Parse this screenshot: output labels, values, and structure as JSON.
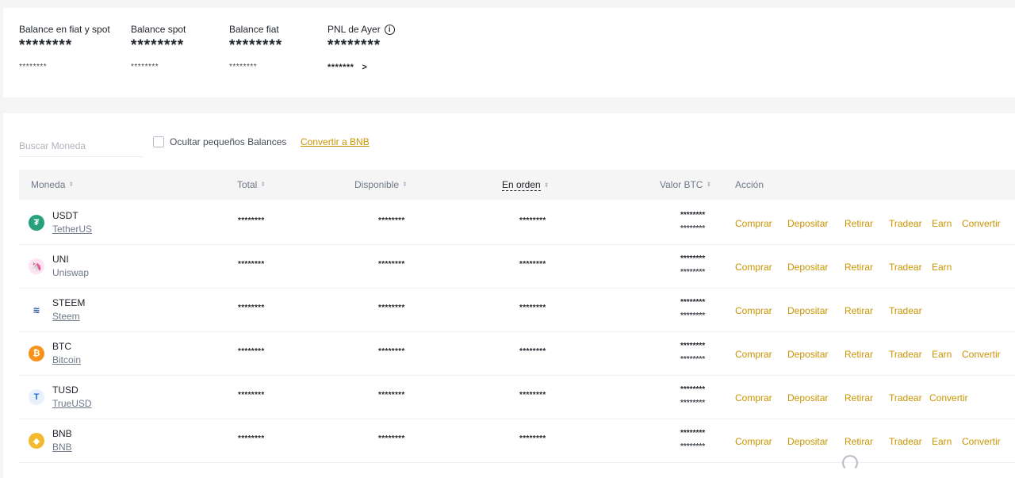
{
  "summary": {
    "fiat_spot": {
      "label": "Balance en fiat y spot",
      "value": "********",
      "sub": "********"
    },
    "spot": {
      "label": "Balance spot",
      "value": "********",
      "sub": "********"
    },
    "fiat": {
      "label": "Balance fiat",
      "value": "********",
      "sub": "********"
    },
    "pnl": {
      "label": "PNL de Ayer",
      "value": "********",
      "sub": "*******",
      "arrow": ">",
      "info_icon": "i"
    }
  },
  "controls": {
    "search_placeholder": "Buscar Moneda",
    "hide_small_label": "Ocultar pequeños Balances",
    "convert_bnb": "Convertir a BNB"
  },
  "table": {
    "headers": {
      "coin": "Moneda",
      "total": "Total",
      "available": "Disponible",
      "in_order": "En orden",
      "btc_value": "Valor BTC",
      "action": "Acción"
    },
    "sort_icon": "⬍",
    "rows": [
      {
        "symbol": "USDT",
        "name": "TetherUS",
        "underline": true,
        "icon": "tether-icon",
        "color": "#26a17b",
        "glyph": "₮",
        "total": "********",
        "available": "********",
        "in_order": "********",
        "btc1": "********",
        "btc2": "********",
        "actions": [
          "Comprar",
          "Depositar",
          "Retirar",
          "Tradear",
          "Earn",
          "Convertir"
        ]
      },
      {
        "symbol": "UNI",
        "name": "Uniswap",
        "underline": false,
        "icon": "uniswap-icon",
        "color": "#ffe3f1",
        "glyph": "🦄",
        "total": "********",
        "available": "********",
        "in_order": "********",
        "btc1": "********",
        "btc2": "********",
        "actions": [
          "Comprar",
          "Depositar",
          "Retirar",
          "Tradear",
          "Earn"
        ]
      },
      {
        "symbol": "STEEM",
        "name": "Steem",
        "underline": true,
        "icon": "steem-icon",
        "color": "#ffffff",
        "glyph": "≋",
        "total": "********",
        "available": "********",
        "in_order": "********",
        "btc1": "********",
        "btc2": "********",
        "actions": [
          "Comprar",
          "Depositar",
          "Retirar",
          "Tradear"
        ]
      },
      {
        "symbol": "BTC",
        "name": "Bitcoin",
        "underline": true,
        "icon": "bitcoin-icon",
        "color": "#f7931a",
        "glyph": "₿",
        "total": "********",
        "available": "********",
        "in_order": "********",
        "btc1": "********",
        "btc2": "********",
        "actions": [
          "Comprar",
          "Depositar",
          "Retirar",
          "Tradear",
          "Earn",
          "Convertir"
        ]
      },
      {
        "symbol": "TUSD",
        "name": "TrueUSD",
        "underline": true,
        "icon": "trueusd-icon",
        "color": "#e8f1fb",
        "glyph": "T",
        "total": "********",
        "available": "********",
        "in_order": "********",
        "btc1": "********",
        "btc2": "********",
        "actions": [
          "Comprar",
          "Depositar",
          "Retirar",
          "Tradear",
          "Convertir"
        ]
      },
      {
        "symbol": "BNB",
        "name": "BNB",
        "underline": true,
        "icon": "bnb-icon",
        "color": "#f3ba2f",
        "glyph": "◆",
        "total": "********",
        "available": "********",
        "in_order": "********",
        "btc1": "********",
        "btc2": "********",
        "actions": [
          "Comprar",
          "Depositar",
          "Retirar",
          "Tradear",
          "Earn",
          "Convertir"
        ]
      }
    ]
  },
  "colors": {
    "accent": "#c99400",
    "text": "#1e2329",
    "muted": "#707a8a"
  }
}
